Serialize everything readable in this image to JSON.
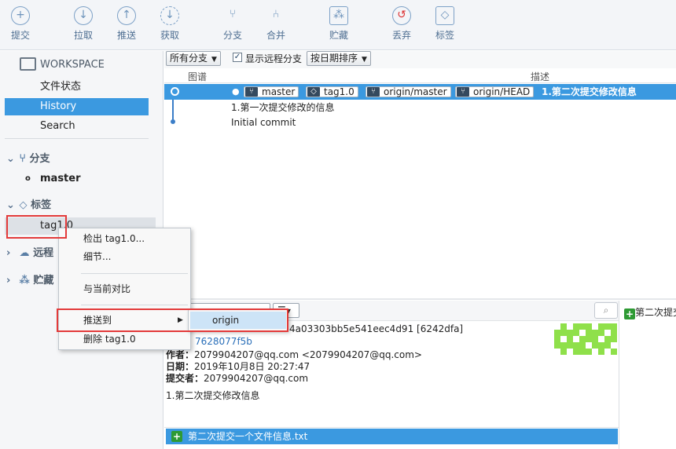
{
  "toolbar": {
    "commit": "提交",
    "pull": "拉取",
    "push": "推送",
    "fetch": "获取",
    "branch": "分支",
    "merge": "合并",
    "stash": "贮藏",
    "discard": "丢弃",
    "tag": "标签"
  },
  "sidebar": {
    "workspace": "WORKSPACE",
    "file_status": "文件状态",
    "history": "History",
    "search": "Search",
    "branches": "分支",
    "master": "master",
    "tags": "标签",
    "tag1": "tag1.0",
    "remotes": "远程",
    "stashes": "贮藏"
  },
  "filter": {
    "all_branches": "所有分支",
    "show_remote": "显示远程分支",
    "sort": "按日期排序"
  },
  "columns": {
    "graph": "图谱",
    "description": "描述"
  },
  "commits": [
    {
      "tags": [
        "master",
        "tag1.0",
        "origin/master",
        "origin/HEAD"
      ],
      "message": "1.第二次提交修改信息"
    },
    {
      "message": "1.第一次提交修改的信息"
    },
    {
      "message": "Initial commit"
    }
  ],
  "details": {
    "hash": "4a03303bb5e541eec4d91 [6242dfa]",
    "parent": "7628077f5b",
    "author_label": "作者：",
    "author": "2079904207@qq.com <2079904207@qq.com>",
    "date_label": "日期：",
    "date": "2019年10月8日 20:27:47",
    "committer_label": "提交者：",
    "committer": "2079904207@qq.com",
    "message": "1.第二次提交修改信息"
  },
  "files": {
    "file1": "第二次提交一个文件信息.txt"
  },
  "right_pane": {
    "header": "第二次提交"
  },
  "context_menu": {
    "checkout": "检出 tag1.0...",
    "details": "细节...",
    "compare": "与当前对比",
    "push_to": "推送到",
    "delete": "删除 tag1.0"
  },
  "submenu": {
    "origin": "origin"
  },
  "colors": {
    "accent": "#3b99e0",
    "highlight_box": "#e33a3a",
    "added_icon": "#2e9a34"
  }
}
